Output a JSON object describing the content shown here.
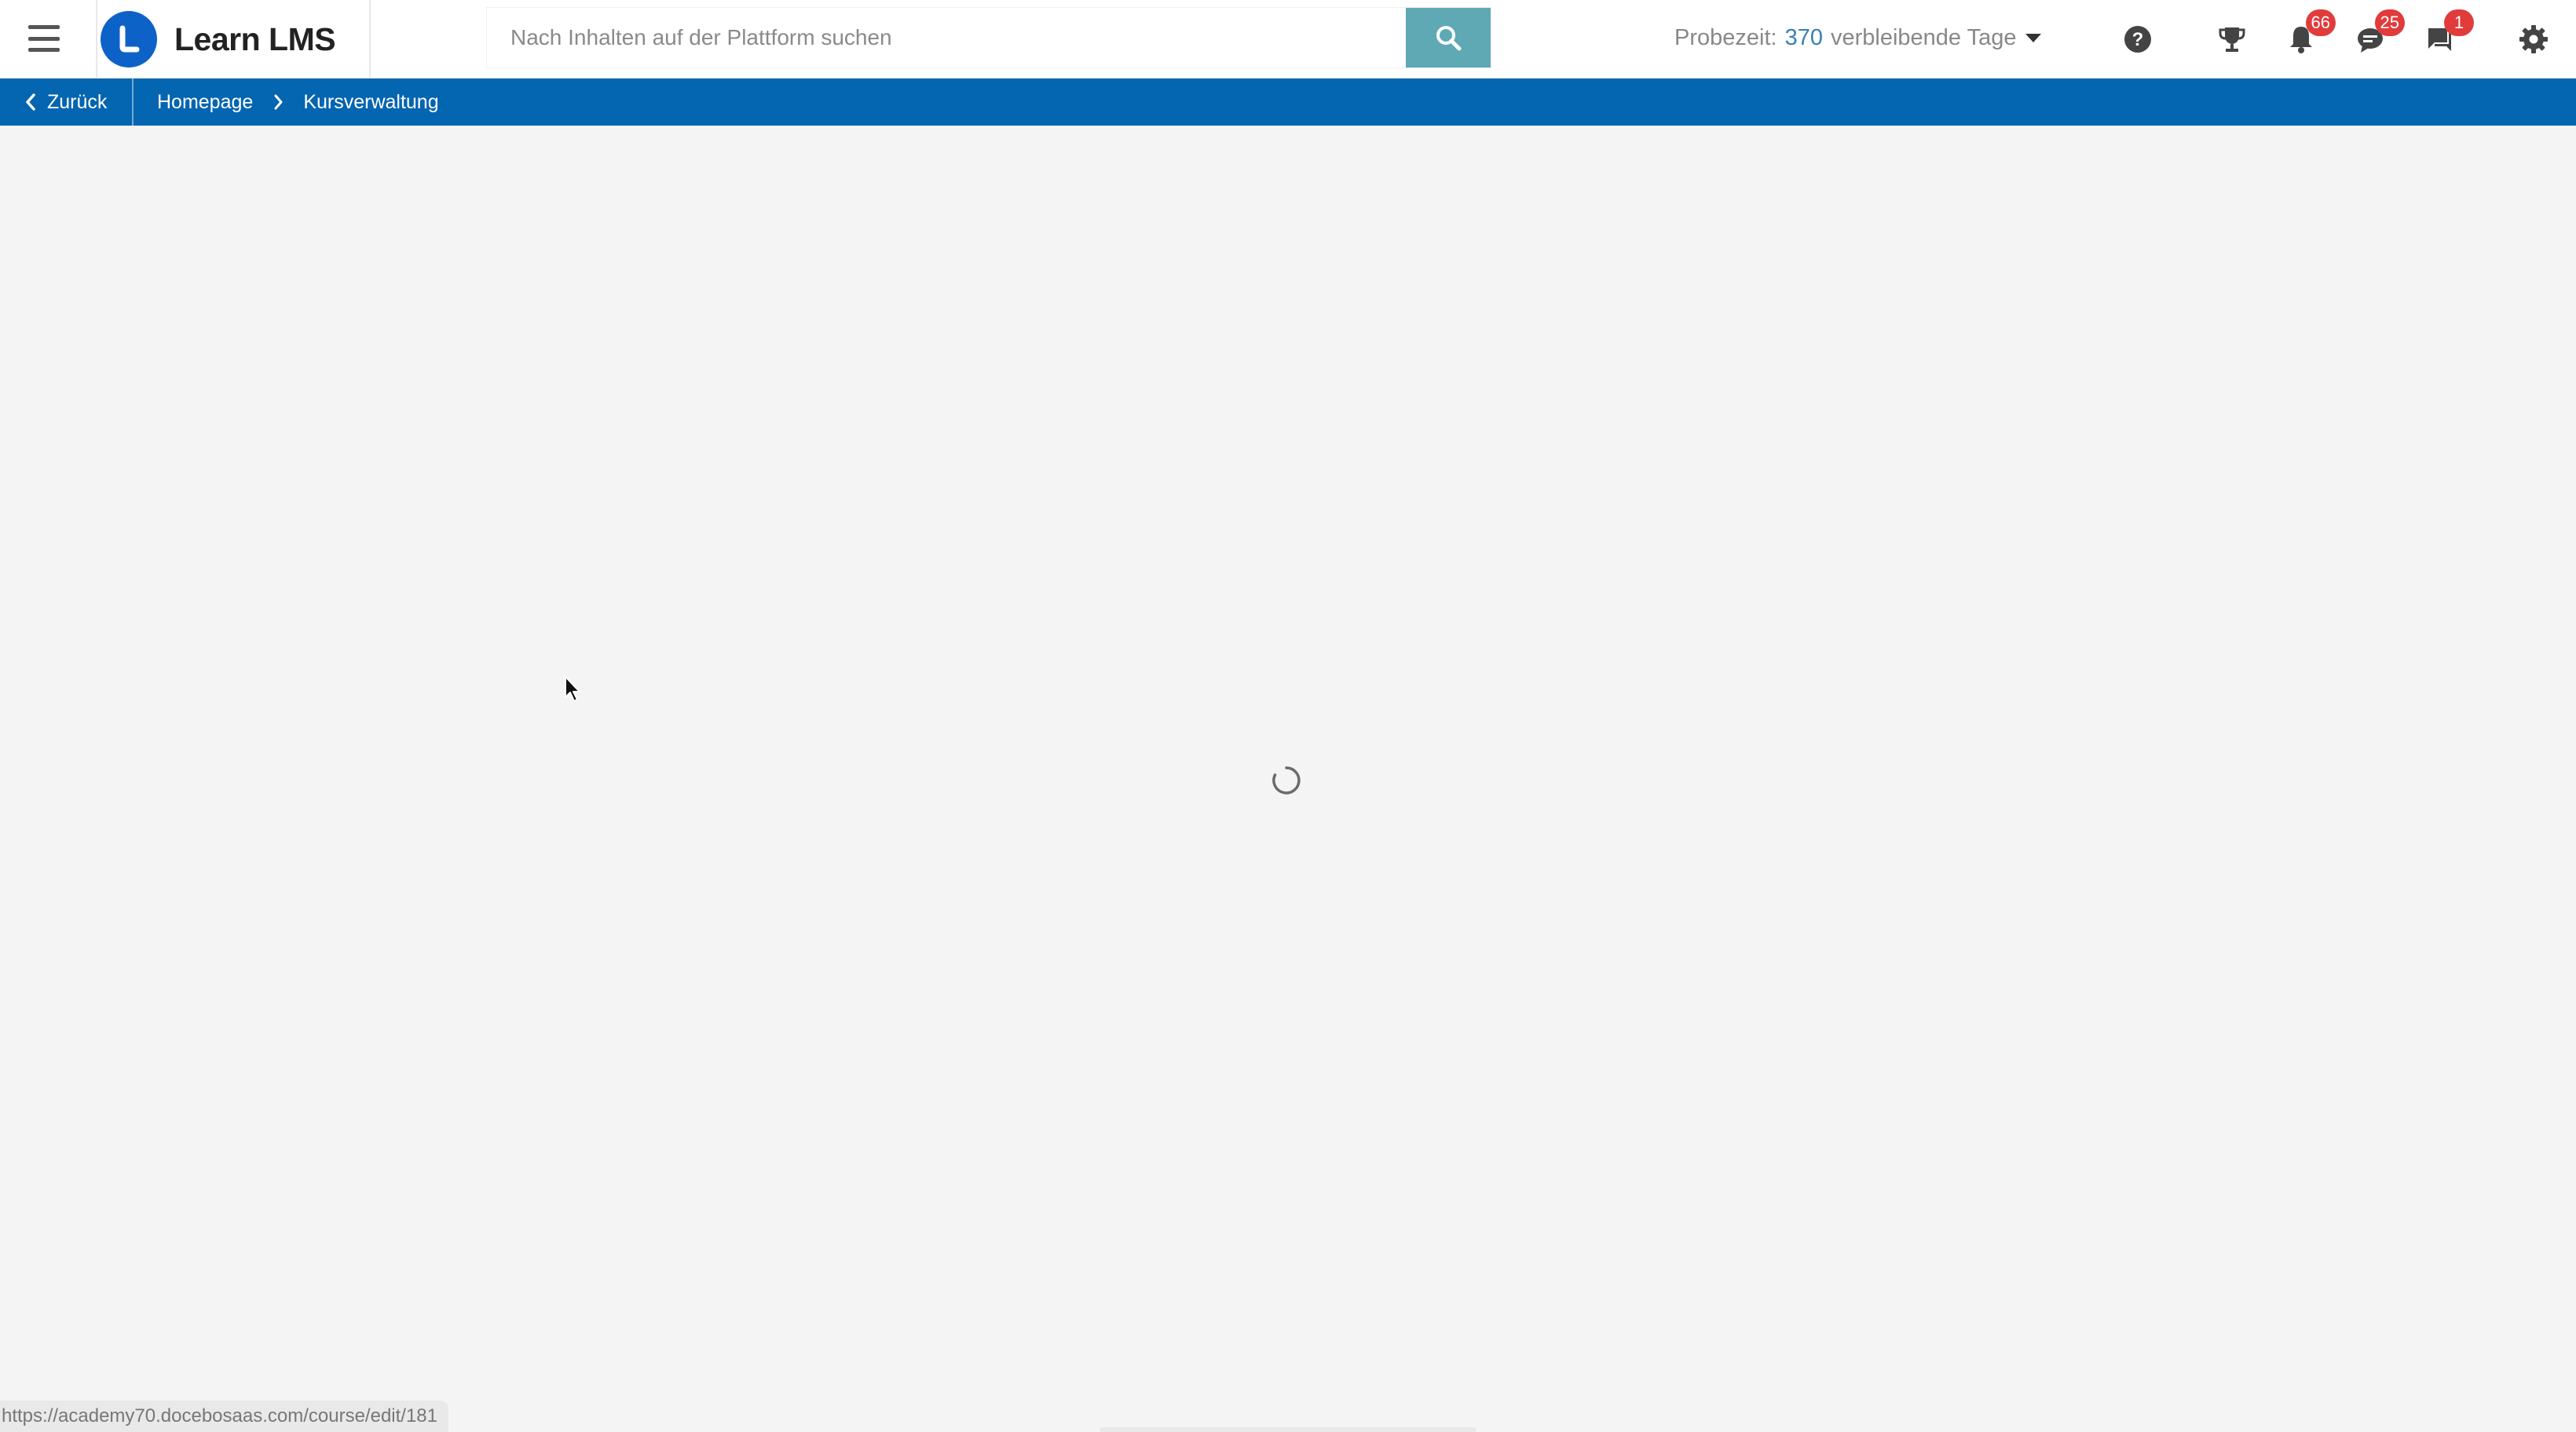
{
  "header": {
    "brand_name": "Learn LMS",
    "search_placeholder": "Nach Inhalten auf der Plattform suchen",
    "trial": {
      "label": "Probezeit:",
      "days": "370",
      "suffix": "verbleibende Tage"
    },
    "badges": {
      "notifications": "66",
      "chat": "25",
      "messages": "1"
    }
  },
  "breadcrumb": {
    "back_label": "Zurück",
    "items": [
      "Homepage",
      "Kursverwaltung"
    ]
  },
  "status_url": "https://academy70.docebosaas.com/course/edit/181",
  "icons": {
    "menu": "hamburger-menu-icon",
    "search": "search-icon",
    "help": "help-icon",
    "trophy": "trophy-icon",
    "bell": "bell-icon",
    "chat": "chat-bubble-icon",
    "messages": "message-icon",
    "settings": "gear-icon",
    "loading": "spinner-icon"
  },
  "colors": {
    "brand_blue": "#0d62c8",
    "breadcrumb_bar": "#0465b0",
    "search_button": "#5fa9b5",
    "badge_red": "#e23b3b",
    "trial_days": "#3a7fb3"
  }
}
